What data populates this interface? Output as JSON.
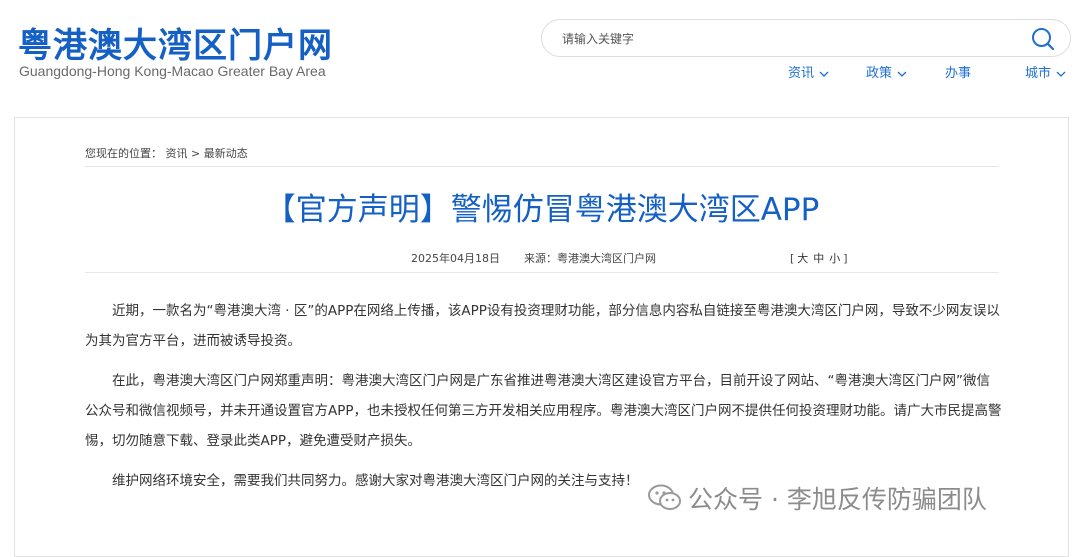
{
  "header": {
    "logo_title": "粤港澳大湾区门户网",
    "logo_subtitle": "Guangdong-Hong Kong-Macao Greater Bay Area",
    "search_placeholder": "请输入关键字",
    "nav": [
      {
        "label": "资讯",
        "has_dropdown": true
      },
      {
        "label": "政策",
        "has_dropdown": true
      },
      {
        "label": "办事",
        "has_dropdown": false
      },
      {
        "label": "城市",
        "has_dropdown": true
      }
    ],
    "accent_color": "#1560c4"
  },
  "article": {
    "breadcrumb_prefix": "您现在的位置：",
    "breadcrumb_items": [
      "资讯",
      "最新动态"
    ],
    "breadcrumb_sep": ">",
    "title": "【官方声明】警惕仿冒粤港澳大湾区APP",
    "date": "2025年04月18日",
    "source": "来源：粤港澳大湾区门户网",
    "font_size_open": "[",
    "font_size_options": [
      "大",
      "中",
      "小"
    ],
    "font_size_close": "]",
    "paragraphs": [
      "近期，一款名为“粤港澳大湾 · 区”的APP在网络上传播，该APP设有投资理财功能，部分信息内容私自链接至粤港澳大湾区门户网，导致不少网友误以为其为官方平台，进而被诱导投资。",
      "在此，粤港澳大湾区门户网郑重声明：粤港澳大湾区门户网是广东省推进粤港澳大湾区建设官方平台，目前开设了网站、“粤港澳大湾区门户网”微信公众号和微信视频号，并未开通设置官方APP，也未授权任何第三方开发相关应用程序。粤港澳大湾区门户网不提供任何投资理财功能。请广大市民提高警惕，切勿随意下载、登录此类APP，避免遭受财产损失。",
      "维护网络环境安全，需要我们共同努力。感谢大家对粤港澳大湾区门户网的关注与支持！"
    ]
  },
  "watermark": {
    "text": "公众号 · 李旭反传防骗团队",
    "icon": "wechat-icon"
  }
}
